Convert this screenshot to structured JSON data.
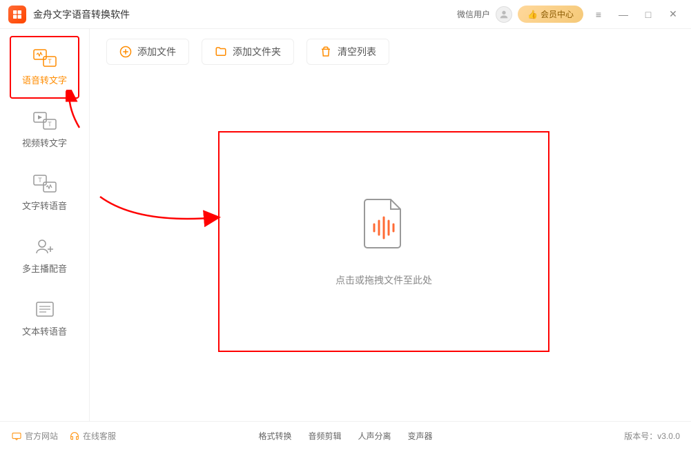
{
  "titlebar": {
    "app_title": "金舟文字语音转换软件",
    "user_label": "微信用户",
    "vip_label": "会员中心"
  },
  "sidebar": {
    "items": [
      {
        "label": "语音转文字",
        "active": true
      },
      {
        "label": "视频转文字",
        "active": false
      },
      {
        "label": "文字转语音",
        "active": false
      },
      {
        "label": "多主播配音",
        "active": false
      },
      {
        "label": "文本转语音",
        "active": false
      }
    ]
  },
  "toolbar": {
    "add_file": "添加文件",
    "add_folder": "添加文件夹",
    "clear_list": "清空列表"
  },
  "dropzone": {
    "hint": "点击或拖拽文件至此处"
  },
  "footer": {
    "official_site": "官方网站",
    "online_service": "在线客服",
    "tabs": [
      "格式转换",
      "音频剪辑",
      "人声分离",
      "变声器"
    ],
    "version_label": "版本号：v3.0.0"
  },
  "colors": {
    "accent": "#ff8c00",
    "highlight": "#ff0000"
  }
}
